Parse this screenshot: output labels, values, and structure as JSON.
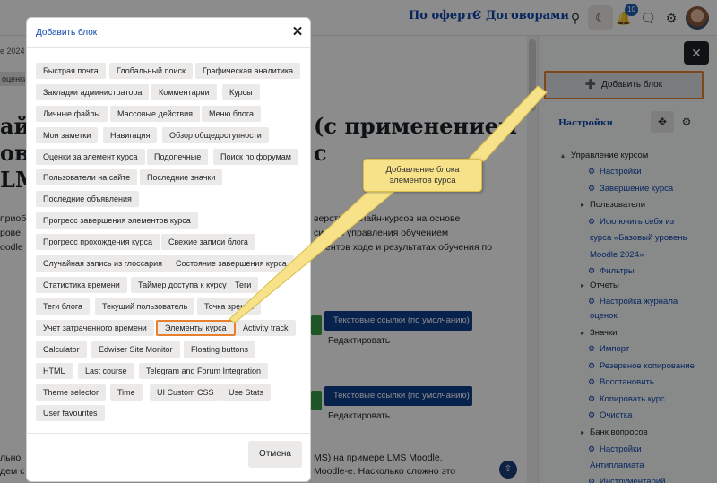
{
  "topbar": {
    "link1": "По оферте",
    "link2": "С Договорами",
    "notification_count": "10"
  },
  "background": {
    "crumb": "е 2024",
    "tag": "оценки",
    "heading_lines": [
      "айн",
      "(с применением",
      "ов в",
      "с",
      "LM"
    ],
    "text_lines": [
      "приоб",
      "верстки онлайн-курсов на основе",
      "рове",
      "систем управления обучением",
      "oodle с",
      "ементов ходе и результатах обучения по"
    ],
    "bottom_text_lines": [
      "льно",
      "MS) на примере LMS Moodle.",
      "дем с",
      "Moodle-е. Насколько сложно это"
    ],
    "format_button_1": "Текстовые ссылки (по умолчанию)",
    "format_button_2": "Текстовые ссылки (по умолчанию)",
    "edit_1": "Редактировать",
    "edit_2": "Редактировать"
  },
  "drawer": {
    "add_block": "Добавить блок",
    "settings_title": "Настройки",
    "tree": [
      {
        "label": "Управление курсом",
        "kind": "caret"
      },
      {
        "label": "Настройки",
        "kind": "link"
      },
      {
        "label": "Завершение курса",
        "kind": "link"
      },
      {
        "label": "Пользователи",
        "kind": "caret"
      },
      {
        "label": "Исключить себя из",
        "kind": "link"
      },
      {
        "label": "курса «Базовый уровень",
        "kind": "link-cont"
      },
      {
        "label": "Moodle 2024»",
        "kind": "link-cont"
      },
      {
        "label": "Фильтры",
        "kind": "link"
      },
      {
        "label": "Отчеты",
        "kind": "caret"
      },
      {
        "label": "Настройка журнала",
        "kind": "link"
      },
      {
        "label": "оценок",
        "kind": "link-cont"
      },
      {
        "label": "Значки",
        "kind": "caret"
      },
      {
        "label": "Импорт",
        "kind": "link"
      },
      {
        "label": "Резервное копирование",
        "kind": "link"
      },
      {
        "label": "Восстановить",
        "kind": "link"
      },
      {
        "label": "Копировать курс",
        "kind": "link"
      },
      {
        "label": "Очистка",
        "kind": "link"
      },
      {
        "label": "Банк вопросов",
        "kind": "caret"
      },
      {
        "label": "Настройки",
        "kind": "link"
      },
      {
        "label": "Антиплагиата",
        "kind": "link-cont"
      },
      {
        "label": "Инструментарий",
        "kind": "link"
      }
    ]
  },
  "modal": {
    "title": "Добавить блок",
    "cancel": "Отмена",
    "blocks": [
      "Быстрая почта",
      "Глобальный поиск",
      "Графическая аналитика",
      "Закладки администратора",
      "Комментарии",
      "Курсы",
      "Личные файлы",
      "Массовые действия",
      "Меню блога",
      "Мои заметки",
      "Навигация",
      "Обзор общедоступности",
      "Оценки за элемент курса",
      "Подопечные",
      "Поиск по форумам",
      "Пользователи на сайте",
      "Последние значки",
      "Последние объявления",
      "Прогресс завершения элементов курса",
      "Прогресс прохождения курса",
      "Свежие записи блога",
      "Случайная запись из глоссария",
      "Состояние завершения курса",
      "Статистика времени",
      "Таймер доступа к курсу",
      "Теги",
      "Теги блога",
      "Текущий пользователь",
      "Точка зрения",
      "Учет затраченного времени",
      "Элементы курса",
      "Activity track",
      "Calculator",
      "Edwiser Site Monitor",
      "Floating buttons",
      "HTML",
      "Last course",
      "Telegram and Forum Integration",
      "Theme selector",
      "Time",
      "UI Custom CSS",
      "Use Stats",
      "User favourites"
    ],
    "highlighted": "Элементы курса"
  },
  "callout": {
    "line1": "Добавление блока",
    "line2": "элементов курса"
  },
  "colors": {
    "accent": "#0f47ad",
    "highlight": "#e8812f",
    "callout": "#f7e28a"
  }
}
